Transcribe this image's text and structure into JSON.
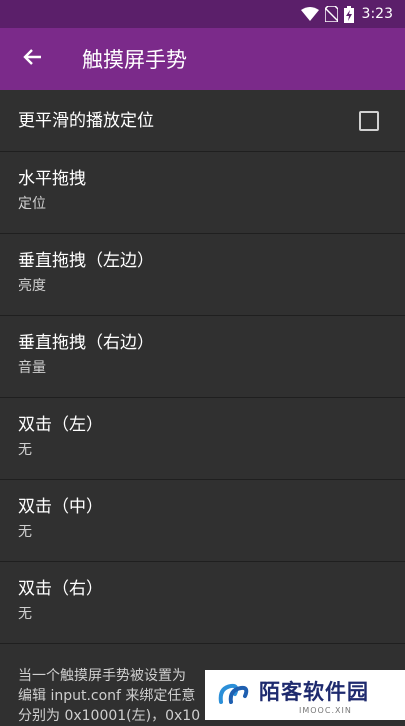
{
  "status_bar": {
    "time": "3:23",
    "icons": [
      "wifi-icon",
      "no-sim-icon",
      "battery-charging-icon"
    ]
  },
  "app_bar": {
    "back_icon": "arrow-back-icon",
    "title": "触摸屏手势"
  },
  "settings": [
    {
      "title": "更平滑的播放定位",
      "summary": "",
      "checkbox": false
    },
    {
      "title": "水平拖拽",
      "summary": "定位"
    },
    {
      "title": "垂直拖拽（左边）",
      "summary": "亮度"
    },
    {
      "title": "垂直拖拽（右边）",
      "summary": "音量"
    },
    {
      "title": "双击（左）",
      "summary": "无"
    },
    {
      "title": "双击（中）",
      "summary": "无"
    },
    {
      "title": "双击（右）",
      "summary": "无"
    }
  ],
  "footer": {
    "lines": [
      "当一个触摸屏手势被设置为",
      "编辑 input.conf 来绑定任意",
      "分别为 0x10001(左)，0x10"
    ]
  },
  "watermark": {
    "main": "陌客软件园",
    "sub": "IMOOC.XIN"
  },
  "colors": {
    "status_bar": "#5b1f6a",
    "app_bar": "#7b2a8a",
    "background": "#303030"
  }
}
